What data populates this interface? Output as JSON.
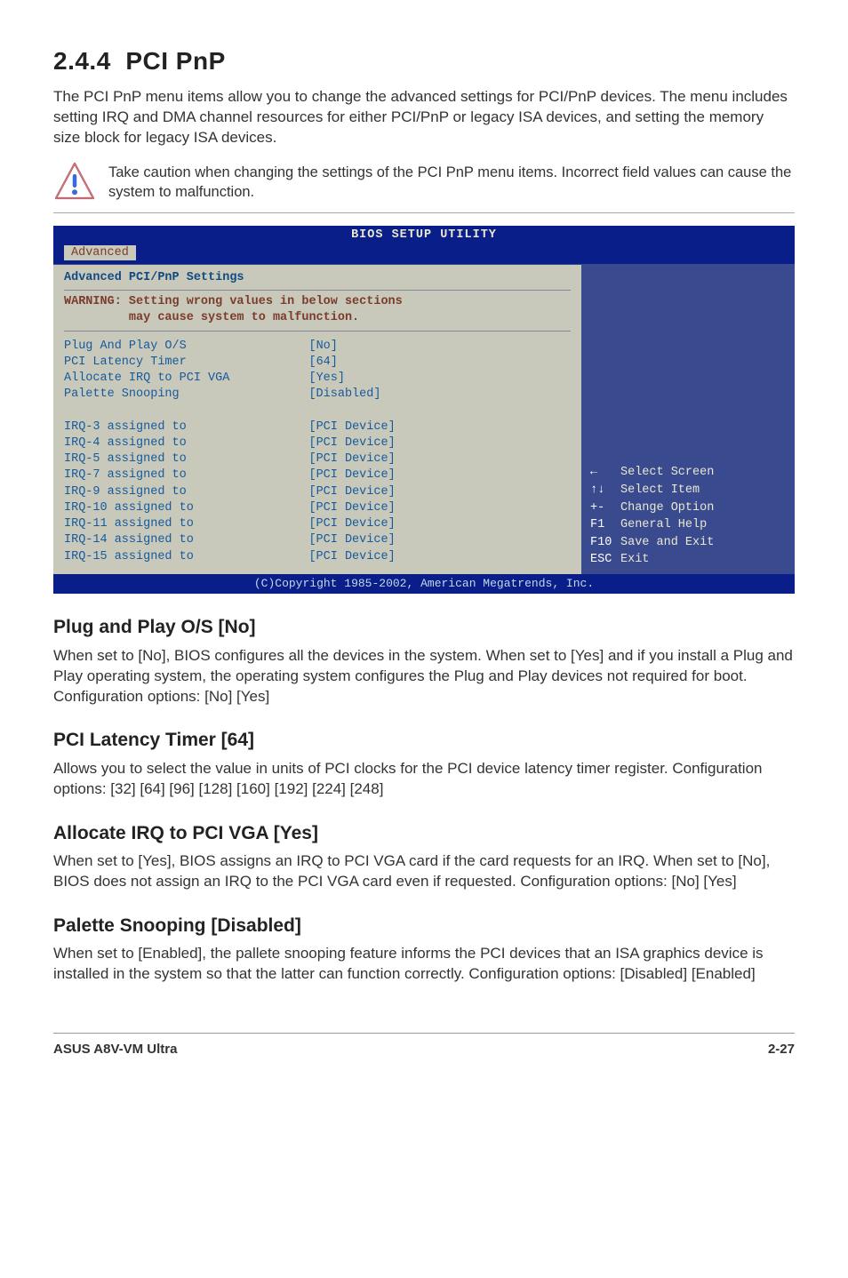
{
  "section": {
    "number": "2.4.4",
    "title": "PCI PnP",
    "intro": "The PCI PnP menu items allow you to change the advanced settings for PCI/PnP devices. The menu includes setting IRQ and DMA channel resources for either PCI/PnP or legacy ISA devices, and setting the memory size block for legacy ISA devices."
  },
  "caution": "Take caution when changing the settings of the PCI PnP menu items. Incorrect field values can cause the system to malfunction.",
  "bios": {
    "title": "BIOS SETUP UTILITY",
    "tab": "Advanced",
    "heading": "Advanced PCI/PnP Settings",
    "warning_label": "WARNING:",
    "warning": " Setting wrong values in below sections\n         may cause system to malfunction.",
    "rows": [
      {
        "label": "Plug And Play O/S",
        "value": "[No]"
      },
      {
        "label": "PCI Latency Timer",
        "value": "[64]"
      },
      {
        "label": "Allocate IRQ to PCI VGA",
        "value": "[Yes]"
      },
      {
        "label": "Palette Snooping",
        "value": "[Disabled]"
      }
    ],
    "irq_rows": [
      {
        "label": "IRQ-3 assigned to",
        "value": "[PCI Device]"
      },
      {
        "label": "IRQ-4 assigned to",
        "value": "[PCI Device]"
      },
      {
        "label": "IRQ-5 assigned to",
        "value": "[PCI Device]"
      },
      {
        "label": "IRQ-7 assigned to",
        "value": "[PCI Device]"
      },
      {
        "label": "IRQ-9 assigned to",
        "value": "[PCI Device]"
      },
      {
        "label": "IRQ-10 assigned to",
        "value": "[PCI Device]"
      },
      {
        "label": "IRQ-11 assigned to",
        "value": "[PCI Device]"
      },
      {
        "label": "IRQ-14 assigned to",
        "value": "[PCI Device]"
      },
      {
        "label": "IRQ-15 assigned to",
        "value": "[PCI Device]"
      }
    ],
    "help_keys": [
      {
        "key": "←",
        "desc": "Select Screen"
      },
      {
        "key": "↑↓",
        "desc": "Select Item"
      },
      {
        "key": "+-",
        "desc": "Change Option"
      },
      {
        "key": "F1",
        "desc": "General Help"
      },
      {
        "key": "F10",
        "desc": "Save and Exit"
      },
      {
        "key": "ESC",
        "desc": "Exit"
      }
    ],
    "footer": "(C)Copyright 1985-2002, American Megatrends, Inc."
  },
  "options": [
    {
      "title": "Plug and Play O/S [No]",
      "body": "When set to [No], BIOS configures all the devices in the system. When set to [Yes] and if you install a Plug and Play operating system, the operating system configures the Plug and Play devices not required for boot. Configuration options: [No] [Yes]"
    },
    {
      "title": "PCI Latency Timer [64]",
      "body": "Allows you to select the value in units of PCI clocks for the PCI device latency timer register. Configuration options: [32] [64] [96] [128] [160] [192] [224] [248]"
    },
    {
      "title": "Allocate IRQ to PCI VGA [Yes]",
      "body": "When set to [Yes], BIOS assigns an IRQ to PCI VGA card if the card requests for an IRQ. When set to [No], BIOS does not assign an IRQ to the PCI VGA card even if requested. Configuration options: [No] [Yes]"
    },
    {
      "title": "Palette Snooping [Disabled]",
      "body": "When set to [Enabled], the pallete snooping feature informs the PCI devices that an ISA graphics device is installed in the system so that the latter can function correctly. Configuration options: [Disabled] [Enabled]"
    }
  ],
  "footer": {
    "left": "ASUS A8V-VM Ultra",
    "right": "2-27"
  }
}
